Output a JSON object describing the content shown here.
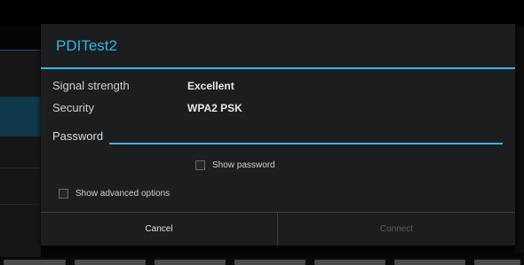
{
  "dialog": {
    "title": "PDITest2",
    "rows": [
      {
        "label": "Signal strength",
        "value": "Excellent"
      },
      {
        "label": "Security",
        "value": "WPA2 PSK"
      }
    ],
    "password": {
      "label": "Password",
      "value": "",
      "placeholder": ""
    },
    "show_password": {
      "label": "Show password",
      "checked": false
    },
    "show_advanced": {
      "label": "Show advanced options",
      "checked": false
    },
    "buttons": {
      "cancel": "Cancel",
      "connect": "Connect"
    }
  },
  "colors": {
    "accent": "#33b5e5",
    "dialog_bg": "#1b1d1e",
    "disabled_text": "#5a5d5f"
  }
}
